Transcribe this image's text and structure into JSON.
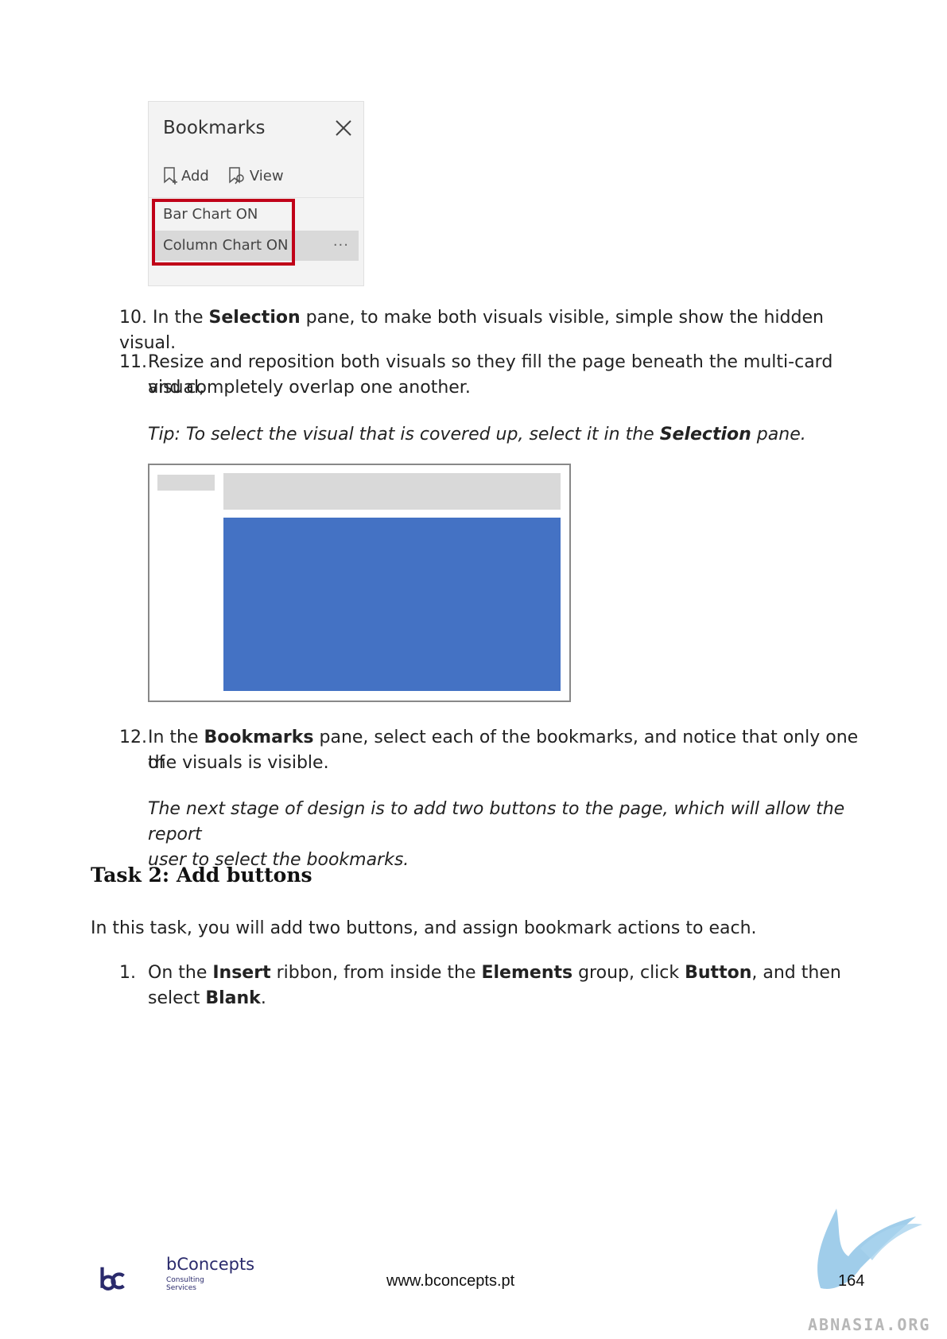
{
  "bookmarks_pane": {
    "title": "Bookmarks",
    "add_label": "Add",
    "view_label": "View",
    "items": [
      "Bar Chart ON",
      "Column Chart ON"
    ],
    "more_label": "···",
    "highlight_color": "#c00018"
  },
  "steps_a": [
    {
      "num": "10.",
      "parts": [
        "In the ",
        "Selection",
        " pane, to make both visuals visible, simple show the hidden visual."
      ]
    },
    {
      "num": "11.",
      "line1": "Resize and reposition both visuals so they fill the page beneath the multi-card visual,",
      "line2": "and completely overlap one another."
    }
  ],
  "tip": {
    "prefix": "Tip: To select the visual that is covered up, select it in the ",
    "bold": "Selection",
    "suffix": " pane."
  },
  "canvas": {
    "visual_color": "#4472c4",
    "placeholder_color": "#d9d9d9"
  },
  "step_12": {
    "num": "12.",
    "prefix": "In the ",
    "bold": "Bookmarks",
    "line1_rest": " pane, select each of the bookmarks, and notice that only one of",
    "line2": "the visuals is visible."
  },
  "note": {
    "line1": "The next stage of design is to add two buttons to the page, which will allow the report",
    "line2": "user to select the bookmarks."
  },
  "task_heading": "Task 2: Add buttons",
  "task_intro": "In this task, you will add two buttons, and assign bookmark actions to each.",
  "step_1": {
    "num": "1.",
    "t1": "On the ",
    "b1": "Insert",
    "t2": " ribbon, from inside the ",
    "b2": "Elements",
    "t3": " group, click ",
    "b3": "Button",
    "t4": ", and then",
    "t5": "select ",
    "b4": "Blank",
    "t6": "."
  },
  "footer": {
    "brand": "bConcepts",
    "brand_sub1": "Consulting",
    "brand_sub2": "Services",
    "url": "www.bconcepts.pt",
    "page": "164",
    "watermark": "ABNASIA.ORG",
    "brand_color": "#2a2a6c"
  }
}
